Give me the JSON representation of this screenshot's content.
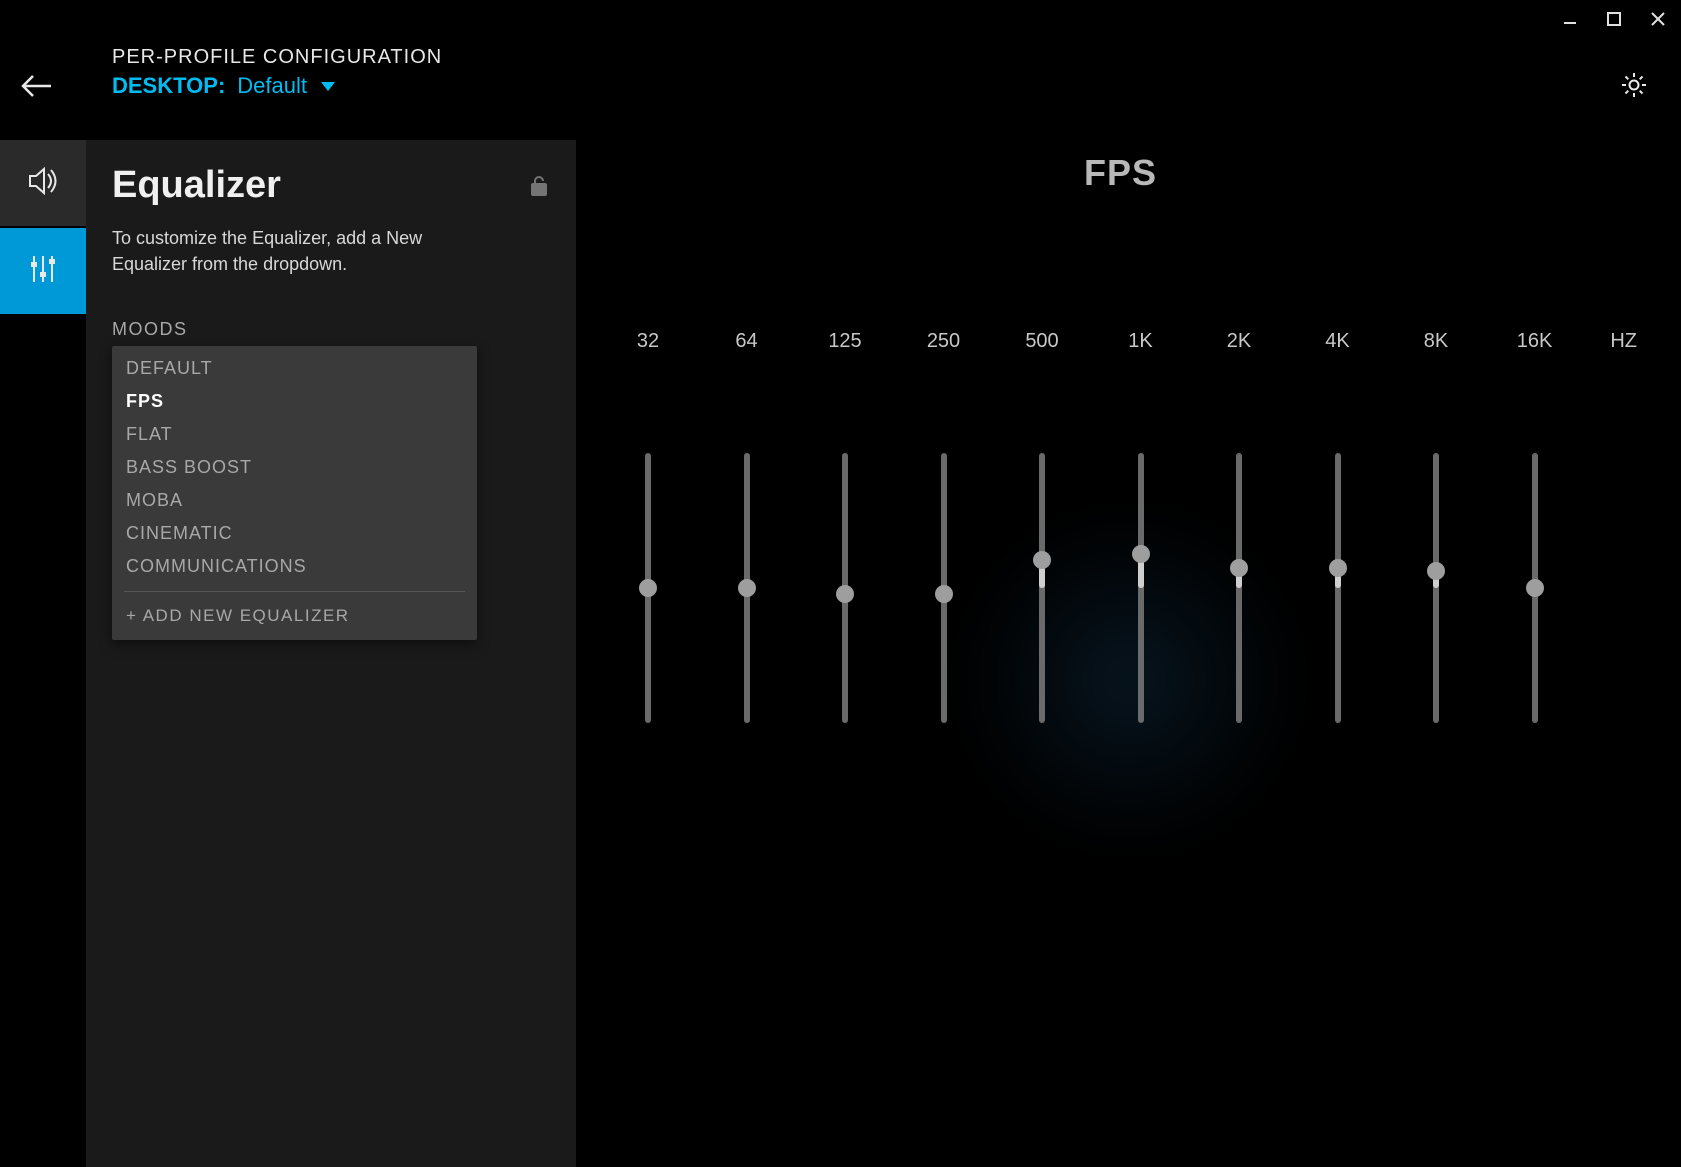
{
  "window_controls": {
    "minimize": "minimize",
    "maximize": "maximize",
    "close": "close"
  },
  "header": {
    "title": "PER-PROFILE CONFIGURATION",
    "profile_label": "DESKTOP:",
    "profile_name": "Default"
  },
  "sidebar": {
    "tabs": [
      {
        "id": "audio",
        "icon": "speaker-icon",
        "active": false
      },
      {
        "id": "equalizer",
        "icon": "sliders-icon",
        "active": true
      }
    ]
  },
  "panel": {
    "title": "Equalizer",
    "description": "To customize the Equalizer, add a New Equalizer from the dropdown.",
    "moods_label": "MOODS",
    "moods": [
      "DEFAULT",
      "FPS",
      "FLAT",
      "BASS BOOST",
      "MOBA",
      "CINEMATIC",
      "COMMUNICATIONS"
    ],
    "selected_mood": "FPS",
    "add_new_label": "+ ADD NEW EQUALIZER"
  },
  "equalizer": {
    "preset_title": "FPS",
    "unit_label": "HZ",
    "bands": [
      {
        "freq": "32",
        "value": 0
      },
      {
        "freq": "64",
        "value": 0
      },
      {
        "freq": "125",
        "value": -0.5
      },
      {
        "freq": "250",
        "value": -0.5
      },
      {
        "freq": "500",
        "value": 2.5
      },
      {
        "freq": "1K",
        "value": 3
      },
      {
        "freq": "2K",
        "value": 1.8
      },
      {
        "freq": "4K",
        "value": 1.8
      },
      {
        "freq": "8K",
        "value": 1.5
      },
      {
        "freq": "16K",
        "value": 0
      }
    ],
    "range_db": 12
  }
}
